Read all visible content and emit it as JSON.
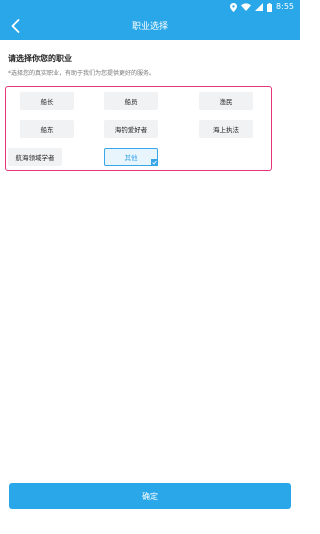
{
  "status_bar": {
    "time": "8:55",
    "icons": [
      "location-icon",
      "wifi-icon",
      "signal-icon",
      "battery-icon"
    ]
  },
  "header": {
    "title": "职业选择",
    "back_icon": "chevron-left-icon"
  },
  "content": {
    "heading": "请选择你您的职业",
    "hint": "*选择您的真实职业，有助于我们为您提供更好的服务。"
  },
  "occupations": [
    {
      "label": "船长",
      "selected": false
    },
    {
      "label": "船员",
      "selected": false
    },
    {
      "label": "渔民",
      "selected": false
    },
    {
      "label": "船东",
      "selected": false
    },
    {
      "label": "海钓爱好者",
      "selected": false
    },
    {
      "label": "海上执法",
      "selected": false
    },
    {
      "label": "航海领域学者",
      "selected": false
    },
    {
      "label": "其他",
      "selected": true
    }
  ],
  "footer": {
    "confirm_label": "确定"
  },
  "colors": {
    "primary": "#2aa7e8",
    "highlight_border": "#e8357a",
    "selected_accent": "#3aa6ea",
    "option_background": "#f1f2f4"
  }
}
